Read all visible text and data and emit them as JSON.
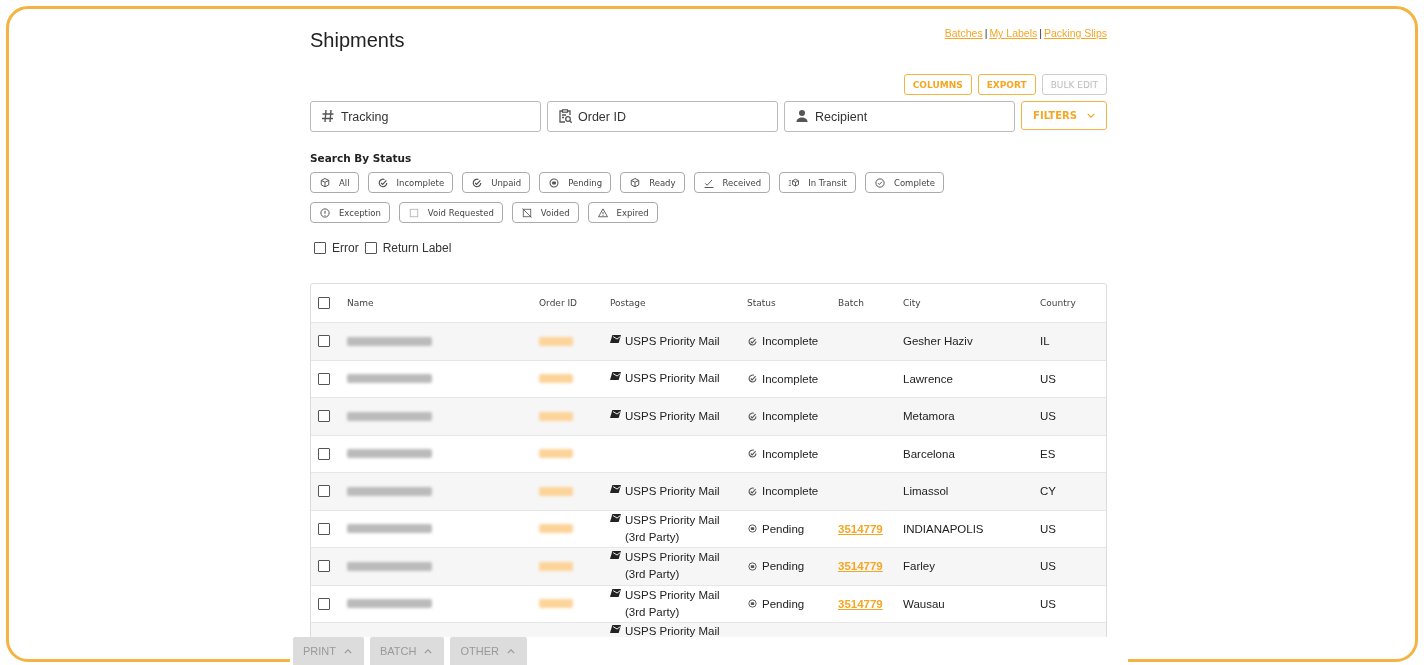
{
  "title": "Shipments",
  "links": [
    "Batches",
    "My Labels",
    "Packing Slips"
  ],
  "link_separator": "|",
  "actions": [
    {
      "label": "COLUMNS",
      "disabled": false
    },
    {
      "label": "EXPORT",
      "disabled": false
    },
    {
      "label": "BULK EDIT",
      "disabled": true
    }
  ],
  "search_fields": [
    {
      "kind": "hash",
      "placeholder": "Tracking"
    },
    {
      "kind": "clipboard",
      "placeholder": "Order ID"
    },
    {
      "kind": "person",
      "placeholder": "Recipient"
    }
  ],
  "filters_button": "FILTERS",
  "status_heading": "Search By Status",
  "status_chips": [
    {
      "kind": "box",
      "label": "All"
    },
    {
      "kind": "incomplete",
      "label": "Incomplete"
    },
    {
      "kind": "incomplete",
      "label": "Unpaid"
    },
    {
      "kind": "pending",
      "label": "Pending"
    },
    {
      "kind": "box",
      "label": "Ready"
    },
    {
      "kind": "received",
      "label": "Received"
    },
    {
      "kind": "transit",
      "label": "In Transit"
    },
    {
      "kind": "complete",
      "label": "Complete"
    },
    {
      "kind": "exception",
      "label": "Exception"
    },
    {
      "kind": "square",
      "label": "Void Requested"
    },
    {
      "kind": "voided",
      "label": "Voided"
    },
    {
      "kind": "warning",
      "label": "Expired"
    }
  ],
  "checkboxes": [
    {
      "label": "Error",
      "checked": false
    },
    {
      "label": "Return Label",
      "checked": false
    }
  ],
  "table": {
    "select_all_checked": false,
    "columns": [
      "Name",
      "Order ID",
      "Postage",
      "Status",
      "Batch",
      "City",
      "Country"
    ],
    "rows": [
      {
        "checked": false,
        "postage": [
          "USPS Priority Mail"
        ],
        "kind": "incomplete",
        "status": "Incomplete",
        "city": "Gesher Haziv",
        "country": "IL"
      },
      {
        "checked": false,
        "postage": [
          "USPS Priority Mail"
        ],
        "kind": "incomplete",
        "status": "Incomplete",
        "city": "Lawrence",
        "country": "US"
      },
      {
        "checked": false,
        "postage": [
          "USPS Priority Mail"
        ],
        "kind": "incomplete",
        "status": "Incomplete",
        "city": "Metamora",
        "country": "US"
      },
      {
        "checked": false,
        "kind": "incomplete",
        "status": "Incomplete",
        "city": "Barcelona",
        "country": "ES"
      },
      {
        "checked": false,
        "postage": [
          "USPS Priority Mail"
        ],
        "kind": "incomplete",
        "status": "Incomplete",
        "city": "Limassol",
        "country": "CY"
      },
      {
        "checked": false,
        "postage": [
          "USPS Priority Mail",
          "(3rd Party)"
        ],
        "kind": "pending",
        "status": "Pending",
        "batch": "3514779",
        "city": "INDIANAPOLIS",
        "country": "US"
      },
      {
        "checked": false,
        "postage": [
          "USPS Priority Mail",
          "(3rd Party)"
        ],
        "kind": "pending",
        "status": "Pending",
        "batch": "3514779",
        "city": "Farley",
        "country": "US"
      },
      {
        "checked": false,
        "postage": [
          "USPS Priority Mail",
          "(3rd Party)"
        ],
        "kind": "pending",
        "status": "Pending",
        "batch": "3514779",
        "city": "Wausau",
        "country": "US"
      },
      {
        "postage": [
          "USPS Priority Mail"
        ]
      }
    ]
  },
  "bottom_buttons": [
    "PRINT",
    "BATCH",
    "OTHER"
  ]
}
